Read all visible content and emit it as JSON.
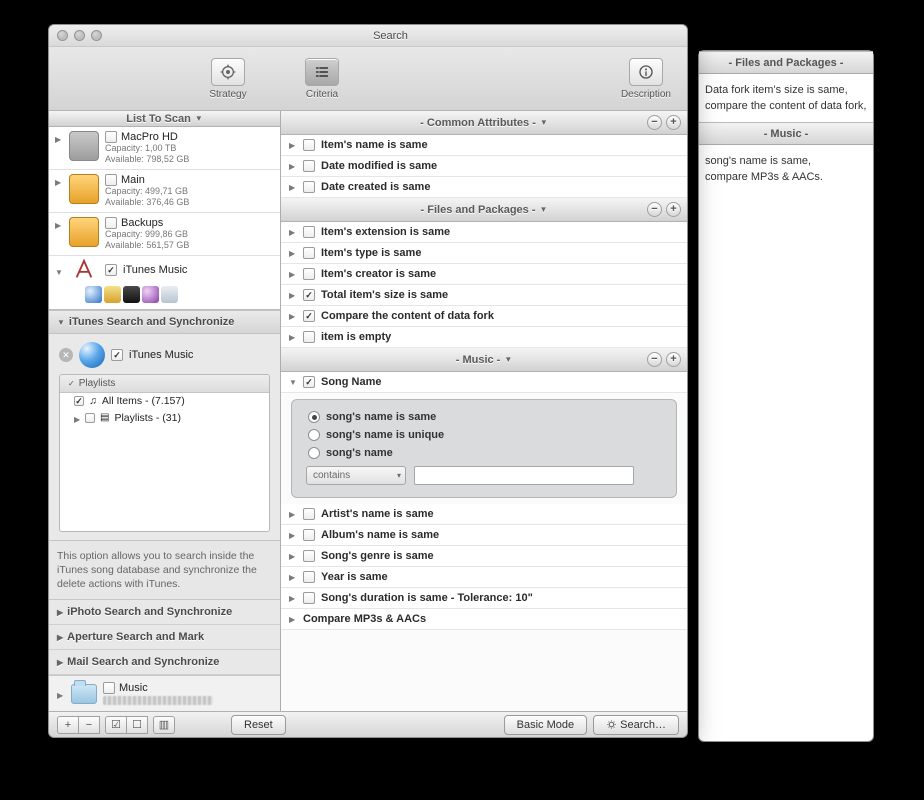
{
  "window": {
    "title": "Search"
  },
  "toolbar": {
    "strategy": "Strategy",
    "criteria": "Criteria",
    "description": "Description"
  },
  "sidebar": {
    "header": "List To Scan",
    "volumes": [
      {
        "name": "MacPro HD",
        "cap": "Capacity: 1,00 TB",
        "avail": "Available: 798,52 GB",
        "type": "hd"
      },
      {
        "name": "Main",
        "cap": "Capacity: 499,71 GB",
        "avail": "Available: 376,46 GB",
        "type": "ext"
      },
      {
        "name": "Backups",
        "cap": "Capacity: 999,86 GB",
        "avail": "Available: 561,57 GB",
        "type": "ext"
      }
    ],
    "itunes_music": "iTunes Music",
    "categories": {
      "itunes": "iTunes Search and Synchronize",
      "iphoto": "iPhoto Search and Synchronize",
      "aperture": "Aperture Search and Mark",
      "mail": "Mail Search and Synchronize"
    },
    "itunes_panel": {
      "label": "iTunes Music",
      "playlists_hdr": "Playlists",
      "all_items": "All Items - (7.157)",
      "playlists": "Playlists - (31)"
    },
    "help": "This option allows you to search inside the iTunes song database and synchronize the delete actions with iTunes.",
    "bottom_folder": "Music"
  },
  "attrs": {
    "common": {
      "title": "Common Attributes",
      "rows": [
        "Item's name is same",
        "Date modified is same",
        "Date created is same"
      ]
    },
    "files": {
      "title": "Files and Packages",
      "rows": [
        {
          "label": "Item's extension is same",
          "checked": false
        },
        {
          "label": "Item's type is same",
          "checked": false
        },
        {
          "label": "Item's creator is same",
          "checked": false
        },
        {
          "label": "Total item's size is same",
          "checked": true
        },
        {
          "label": "Compare the content of data fork",
          "checked": true
        },
        {
          "label": "item is empty",
          "checked": false
        }
      ]
    },
    "music": {
      "title": "Music",
      "song_name": "Song Name",
      "radios": [
        "song's name is same",
        "song's name is unique",
        "song's name"
      ],
      "select": "contains",
      "rest": [
        "Artist's name is same",
        "Album's name is same",
        "Song's genre is same",
        "Year is same",
        "Song's duration is same - Tolerance: 10\"",
        "Compare MP3s & AACs"
      ]
    }
  },
  "buttons": {
    "reset": "Reset",
    "basic": "Basic Mode",
    "search": "Search…"
  },
  "bgwin": {
    "files_title": "- Files and Packages -",
    "files_body1": "Data fork item's size is same,",
    "files_body2": "compare the content of data fork,",
    "music_title": "- Music -",
    "music_body1": "song's name is same,",
    "music_body2": "compare MP3s & AACs."
  }
}
